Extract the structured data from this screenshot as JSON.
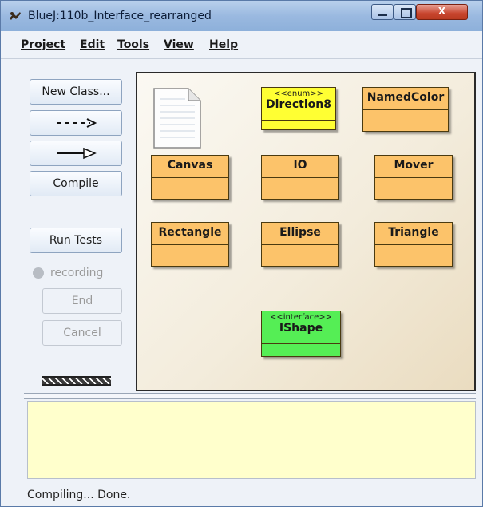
{
  "window": {
    "title": "BlueJ:110b_Interface_rearranged",
    "close_glyph": "X"
  },
  "menu": [
    {
      "label": "Project"
    },
    {
      "label": "Edit"
    },
    {
      "label": "Tools"
    },
    {
      "label": "View"
    },
    {
      "label": "Help"
    }
  ],
  "toolbar": {
    "new_class": "New Class...",
    "dependency_arrow": "- - ->",
    "inheritance_arrow": "—▷",
    "compile": "Compile",
    "run_tests": "Run Tests",
    "recording": "recording",
    "end": "End",
    "cancel": "Cancel"
  },
  "classes": [
    {
      "name": "Direction8",
      "stereotype": "<<enum>>",
      "kind": "enum",
      "color": "#ffff33"
    },
    {
      "name": "NamedColor",
      "kind": "class",
      "color": "#fcc36a"
    },
    {
      "name": "Canvas",
      "kind": "class",
      "color": "#fcc36a"
    },
    {
      "name": "IO",
      "kind": "class",
      "color": "#fcc36a"
    },
    {
      "name": "Mover",
      "kind": "class",
      "color": "#fcc36a"
    },
    {
      "name": "Rectangle",
      "kind": "class",
      "color": "#fcc36a"
    },
    {
      "name": "Ellipse",
      "kind": "class",
      "color": "#fcc36a"
    },
    {
      "name": "Triangle",
      "kind": "class",
      "color": "#fcc36a"
    },
    {
      "name": "IShape",
      "stereotype": "<<interface>>",
      "kind": "interface",
      "color": "#55ee55"
    }
  ],
  "readme_icon": "readme-document-icon",
  "status": "Compiling... Done."
}
